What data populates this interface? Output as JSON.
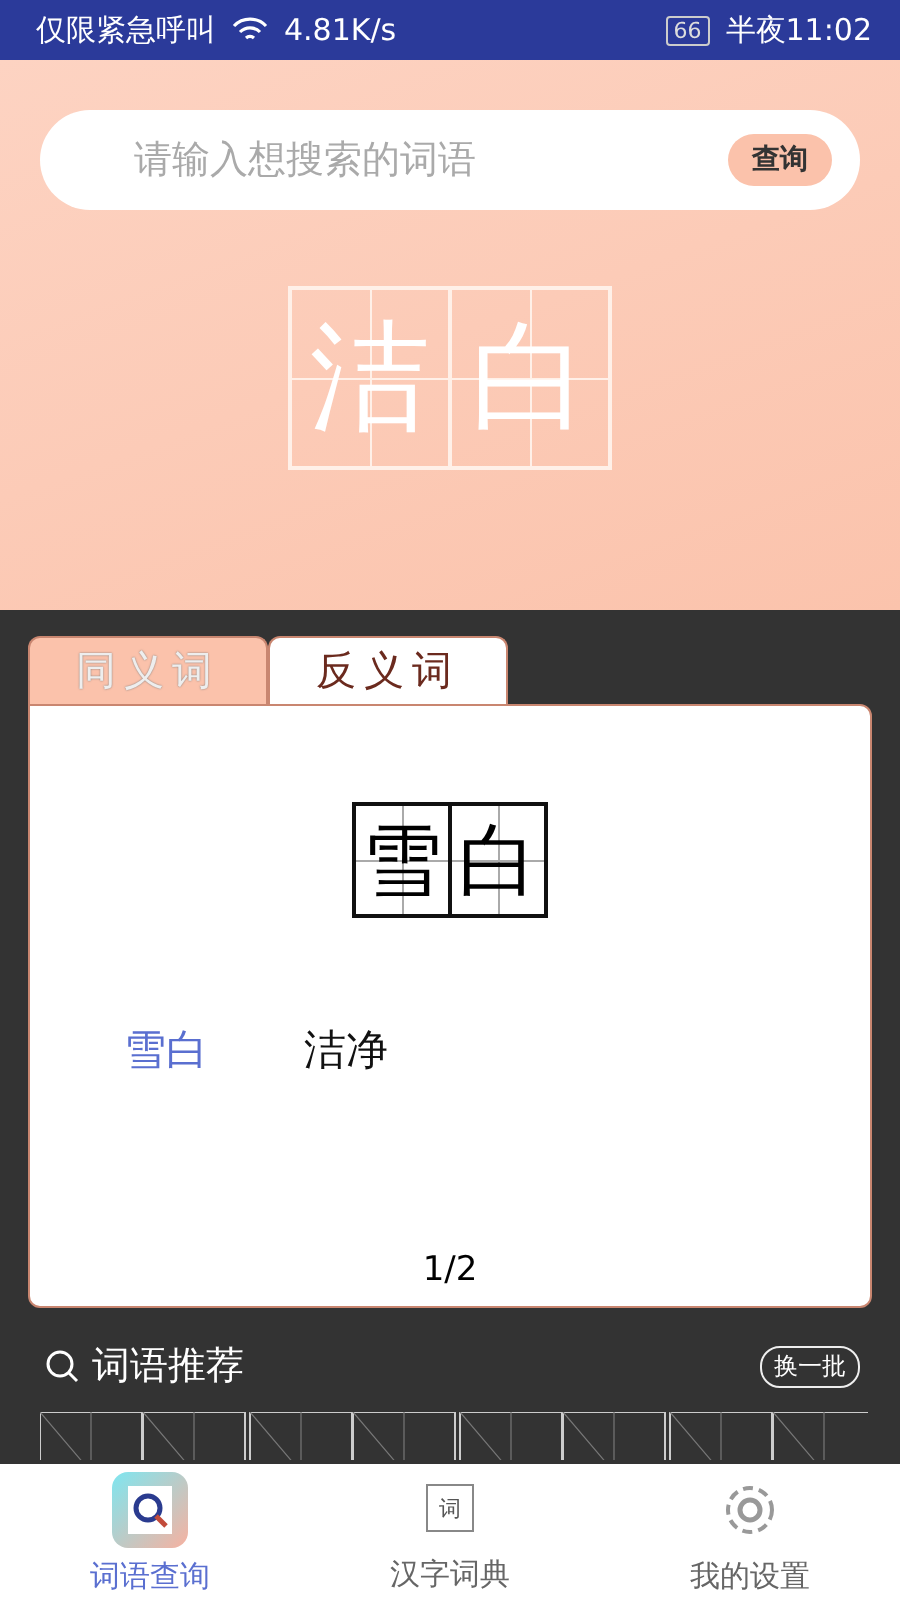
{
  "status_bar": {
    "carrier": "仅限紧急呼叫",
    "speed": "4.81K/s",
    "battery": "66",
    "time": "半夜11:02"
  },
  "search": {
    "placeholder": "请输入想搜索的词语",
    "button": "查询"
  },
  "word": [
    "洁",
    "白"
  ],
  "tabs": [
    {
      "label": "同义词",
      "selected": false
    },
    {
      "label": "反义词",
      "selected": true
    }
  ],
  "card": {
    "word": [
      "雪",
      "白"
    ],
    "results": [
      {
        "text": "雪白",
        "selected": true
      },
      {
        "text": "洁净",
        "selected": false
      }
    ],
    "page": "1/2"
  },
  "recommend": {
    "title": "词语推荐",
    "refresh": "换一批"
  },
  "nav": [
    {
      "label": "词语查询",
      "kind": "search",
      "selected": true
    },
    {
      "label": "汉字词典",
      "kind": "dict",
      "icon_text": "词",
      "selected": false
    },
    {
      "label": "我的设置",
      "kind": "settings",
      "selected": false
    }
  ]
}
